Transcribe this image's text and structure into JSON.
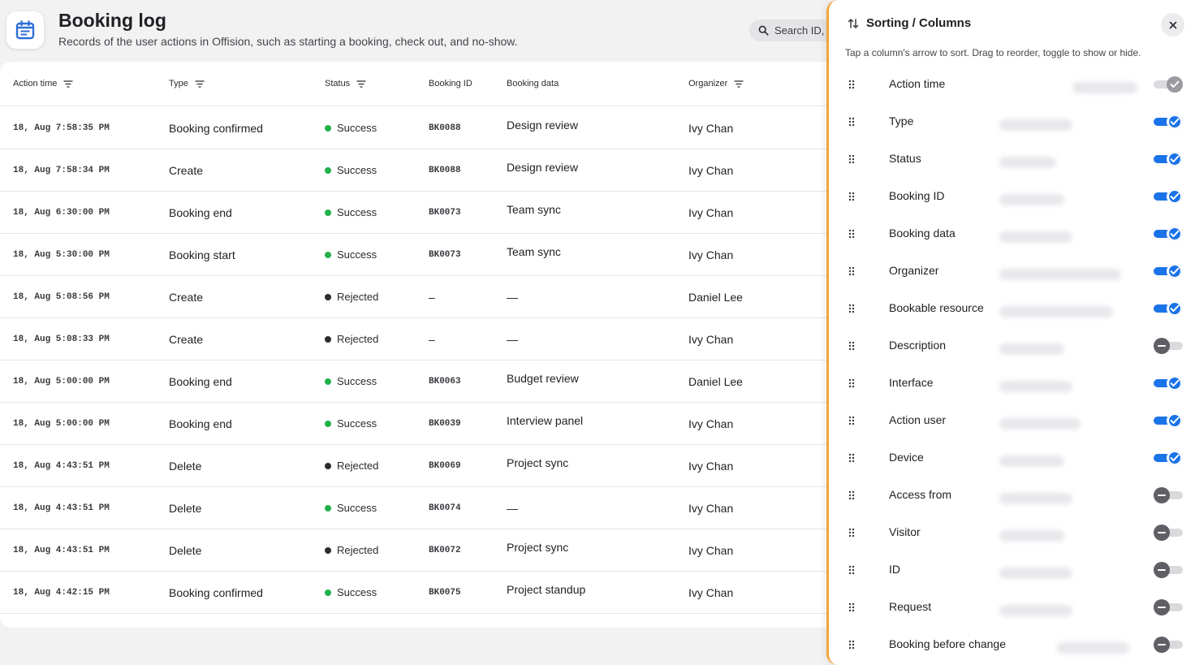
{
  "header": {
    "title": "Booking log",
    "subtitle": "Records of the user actions in Offision, such as starting a booking, check out, and no-show.",
    "search_placeholder": "Search ID, ..."
  },
  "table": {
    "columns": [
      {
        "label": "Action time",
        "filter": true
      },
      {
        "label": "Type",
        "filter": true
      },
      {
        "label": "Status",
        "filter": true
      },
      {
        "label": "Booking ID",
        "filter": false
      },
      {
        "label": "Booking data",
        "filter": false
      },
      {
        "label": "Organizer",
        "filter": true
      }
    ],
    "rows": [
      {
        "time": "18, Aug 7:58:35 PM",
        "type": "Booking confirmed",
        "status": "Success",
        "booking_id": "BK0088",
        "booking_data": "Design review",
        "organizer": "Ivy Chan"
      },
      {
        "time": "18, Aug 7:58:34 PM",
        "type": "Create",
        "status": "Success",
        "booking_id": "BK0088",
        "booking_data": "Design review",
        "organizer": "Ivy Chan"
      },
      {
        "time": "18, Aug 6:30:00 PM",
        "type": "Booking end",
        "status": "Success",
        "booking_id": "BK0073",
        "booking_data": "Team sync",
        "organizer": "Ivy Chan"
      },
      {
        "time": "18, Aug 5:30:00 PM",
        "type": "Booking start",
        "status": "Success",
        "booking_id": "BK0073",
        "booking_data": "Team sync",
        "organizer": "Ivy Chan"
      },
      {
        "time": "18, Aug 5:08:56 PM",
        "type": "Create",
        "status": "Rejected",
        "booking_id": "–",
        "booking_data": "—",
        "organizer": "Daniel Lee"
      },
      {
        "time": "18, Aug 5:08:33 PM",
        "type": "Create",
        "status": "Rejected",
        "booking_id": "–",
        "booking_data": "—",
        "organizer": "Ivy Chan"
      },
      {
        "time": "18, Aug 5:00:00 PM",
        "type": "Booking end",
        "status": "Success",
        "booking_id": "BK0063",
        "booking_data": "Budget review",
        "organizer": "Daniel Lee"
      },
      {
        "time": "18, Aug 5:00:00 PM",
        "type": "Booking end",
        "status": "Success",
        "booking_id": "BK0039",
        "booking_data": "Interview panel",
        "organizer": "Ivy Chan"
      },
      {
        "time": "18, Aug 4:43:51 PM",
        "type": "Delete",
        "status": "Rejected",
        "booking_id": "BK0069",
        "booking_data": "Project sync",
        "organizer": "Ivy Chan"
      },
      {
        "time": "18, Aug 4:43:51 PM",
        "type": "Delete",
        "status": "Success",
        "booking_id": "BK0074",
        "booking_data": "—",
        "organizer": "Ivy Chan"
      },
      {
        "time": "18, Aug 4:43:51 PM",
        "type": "Delete",
        "status": "Rejected",
        "booking_id": "BK0072",
        "booking_data": "Project sync",
        "organizer": "Ivy Chan"
      },
      {
        "time": "18, Aug 4:42:15 PM",
        "type": "Booking confirmed",
        "status": "Success",
        "booking_id": "BK0075",
        "booking_data": "Project standup",
        "organizer": "Ivy Chan"
      }
    ]
  },
  "status_colors": {
    "Success": "#22b14c",
    "Rejected": "#2b2b30"
  },
  "panel": {
    "title": "Sorting / Columns",
    "hint": "Tap a column's arrow to sort. Drag to reorder, toggle to show or hide.",
    "items": [
      {
        "label": "Action time",
        "state": "locked"
      },
      {
        "label": "Type",
        "state": "on"
      },
      {
        "label": "Status",
        "state": "on"
      },
      {
        "label": "Booking ID",
        "state": "on"
      },
      {
        "label": "Booking data",
        "state": "on"
      },
      {
        "label": "Organizer",
        "state": "on"
      },
      {
        "label": "Bookable resource",
        "state": "on"
      },
      {
        "label": "Description",
        "state": "off"
      },
      {
        "label": "Interface",
        "state": "on"
      },
      {
        "label": "Action user",
        "state": "on"
      },
      {
        "label": "Device",
        "state": "on"
      },
      {
        "label": "Access from",
        "state": "off"
      },
      {
        "label": "Visitor",
        "state": "off"
      },
      {
        "label": "ID",
        "state": "off"
      },
      {
        "label": "Request",
        "state": "off"
      },
      {
        "label": "Booking before change",
        "state": "off"
      }
    ]
  },
  "colors": {
    "accent": "#1a73e8",
    "panel_border": "#f4a33a"
  }
}
